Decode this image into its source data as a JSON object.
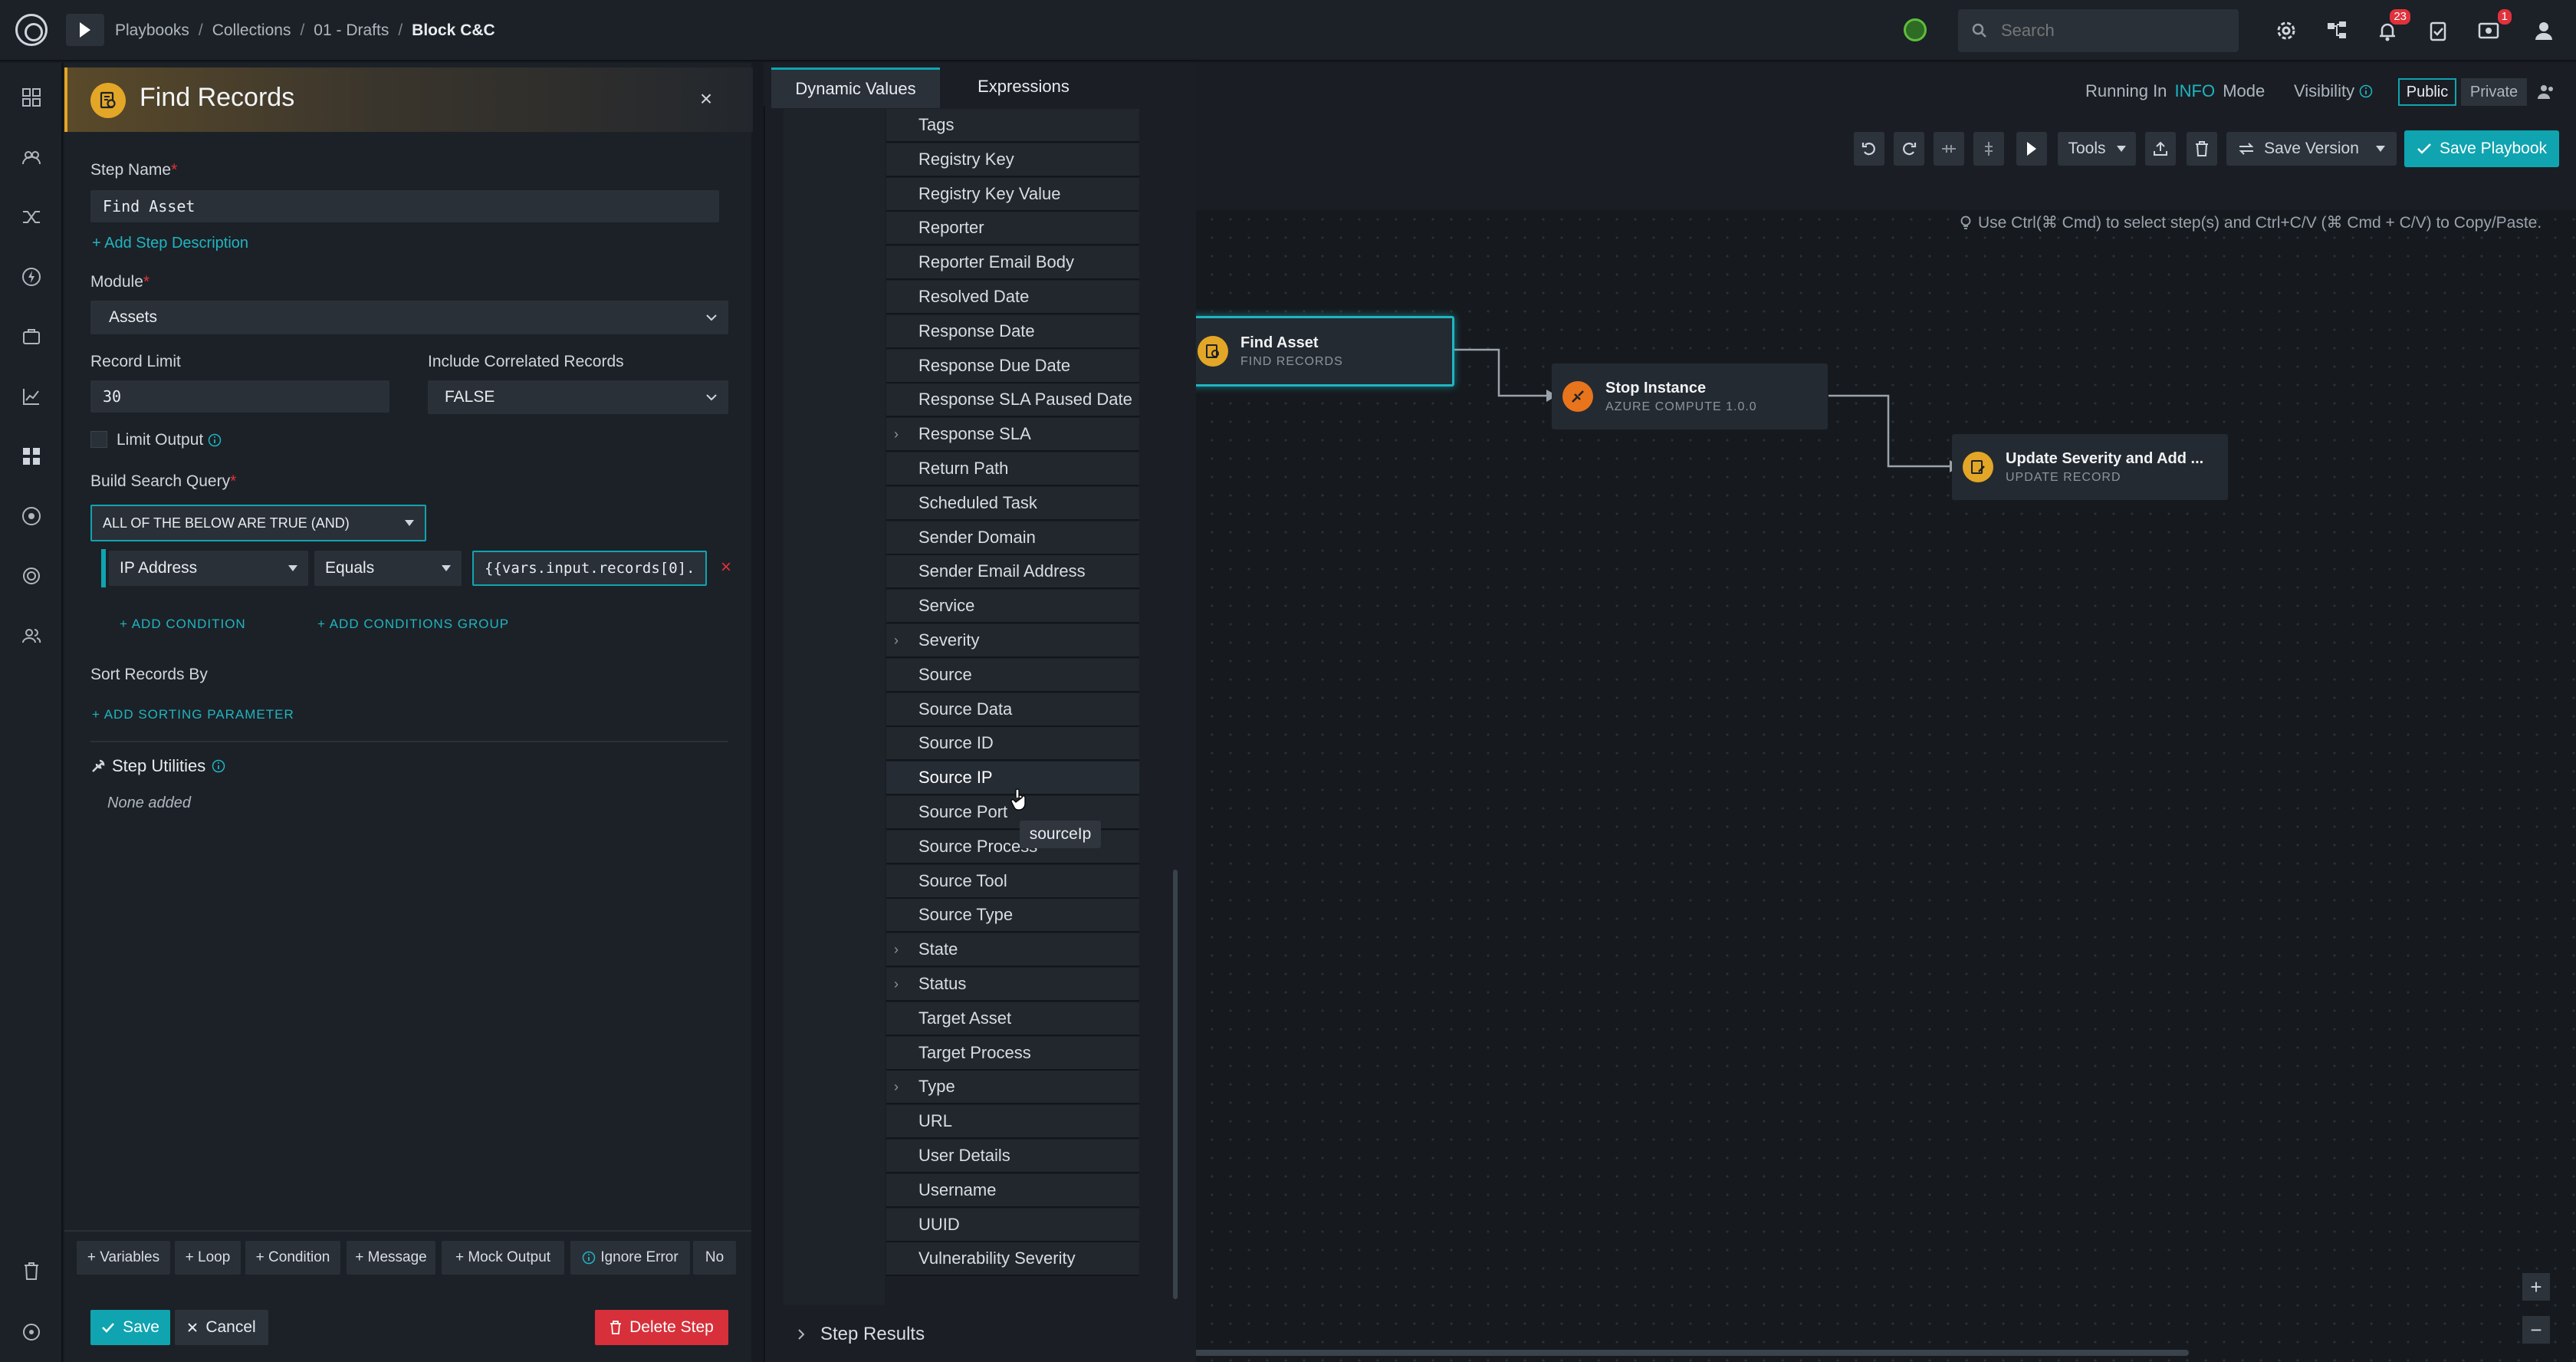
{
  "breadcrumb": [
    "Playbooks",
    "Collections",
    "01 - Drafts",
    "Block C&C"
  ],
  "search": {
    "placeholder": "Search"
  },
  "notifications": {
    "count": "23"
  },
  "settings_badge": {
    "count": "1"
  },
  "header": {
    "running_in": "Running In",
    "mode_value": "INFO",
    "mode_label": "Mode",
    "visibility": "Visibility",
    "public": "Public",
    "private": "Private"
  },
  "toolbar": {
    "tools": "Tools",
    "save_version": "Save Version",
    "save_playbook": "Save Playbook"
  },
  "hint": "Use Ctrl(⌘ Cmd) to select step(s) and Ctrl+C/V (⌘ Cmd + C/V) to Copy/Paste.",
  "nodes": [
    {
      "title": "Find Asset",
      "subtitle": "FIND RECORDS"
    },
    {
      "title": "Stop Instance",
      "subtitle": "AZURE COMPUTE 1.0.0"
    },
    {
      "title": "Update Severity and Add ...",
      "subtitle": "UPDATE RECORD"
    }
  ],
  "dynamic_values": {
    "tab_dynamic": "Dynamic Values",
    "tab_expressions": "Expressions",
    "items": [
      {
        "label": "Tags",
        "expandable": false
      },
      {
        "label": "Registry Key",
        "expandable": false
      },
      {
        "label": "Registry Key Value",
        "expandable": false
      },
      {
        "label": "Reporter",
        "expandable": false
      },
      {
        "label": "Reporter Email Body",
        "expandable": false
      },
      {
        "label": "Resolved Date",
        "expandable": false
      },
      {
        "label": "Response Date",
        "expandable": false
      },
      {
        "label": "Response Due Date",
        "expandable": false
      },
      {
        "label": "Response SLA Paused Date",
        "expandable": false
      },
      {
        "label": "Response SLA",
        "expandable": true
      },
      {
        "label": "Return Path",
        "expandable": false
      },
      {
        "label": "Scheduled Task",
        "expandable": false
      },
      {
        "label": "Sender Domain",
        "expandable": false
      },
      {
        "label": "Sender Email Address",
        "expandable": false
      },
      {
        "label": "Service",
        "expandable": false
      },
      {
        "label": "Severity",
        "expandable": true
      },
      {
        "label": "Source",
        "expandable": false
      },
      {
        "label": "Source Data",
        "expandable": false
      },
      {
        "label": "Source ID",
        "expandable": false
      },
      {
        "label": "Source IP",
        "expandable": false
      },
      {
        "label": "Source Port",
        "expandable": false
      },
      {
        "label": "Source Process",
        "expandable": false
      },
      {
        "label": "Source Tool",
        "expandable": false
      },
      {
        "label": "Source Type",
        "expandable": false
      },
      {
        "label": "State",
        "expandable": true
      },
      {
        "label": "Status",
        "expandable": true
      },
      {
        "label": "Target Asset",
        "expandable": false
      },
      {
        "label": "Target Process",
        "expandable": false
      },
      {
        "label": "Type",
        "expandable": true
      },
      {
        "label": "URL",
        "expandable": false
      },
      {
        "label": "User Details",
        "expandable": false
      },
      {
        "label": "Username",
        "expandable": false
      },
      {
        "label": "UUID",
        "expandable": false
      },
      {
        "label": "Vulnerability Severity",
        "expandable": false
      }
    ],
    "tooltip": "sourceIp",
    "step_results": "Step Results"
  },
  "find_records": {
    "title": "Find Records",
    "step_name_label": "Step Name",
    "step_name_value": "Find Asset",
    "add_description": "+ Add Step Description",
    "module_label": "Module",
    "module_value": "Assets",
    "record_limit_label": "Record Limit",
    "record_limit_value": "30",
    "include_correlated_label": "Include Correlated Records",
    "include_correlated_value": "FALSE",
    "limit_output_label": "Limit Output",
    "build_query_label": "Build Search Query",
    "logic_value": "ALL OF THE BELOW ARE TRUE (AND)",
    "condition_field": "IP Address",
    "condition_operator": "Equals",
    "condition_value": "{{vars.input.records[0].",
    "add_condition": "+ ADD CONDITION",
    "add_conditions_group": "+ ADD CONDITIONS GROUP",
    "sort_label": "Sort Records By",
    "add_sorting": "+ ADD SORTING PARAMETER",
    "step_utilities": "Step Utilities",
    "none_added": "None added",
    "utilities": [
      "+ Variables",
      "+ Loop",
      "+ Condition",
      "+ Message",
      "+ Mock Output"
    ],
    "ignore_error": "Ignore Error",
    "ignore_error_value": "No",
    "save": "Save",
    "cancel": "Cancel",
    "delete_step": "Delete Step"
  },
  "colors": {
    "accent": "#0fa4b0",
    "step_icon": "#e3a627",
    "azure_icon": "#e8741c",
    "danger": "#d7303a"
  }
}
